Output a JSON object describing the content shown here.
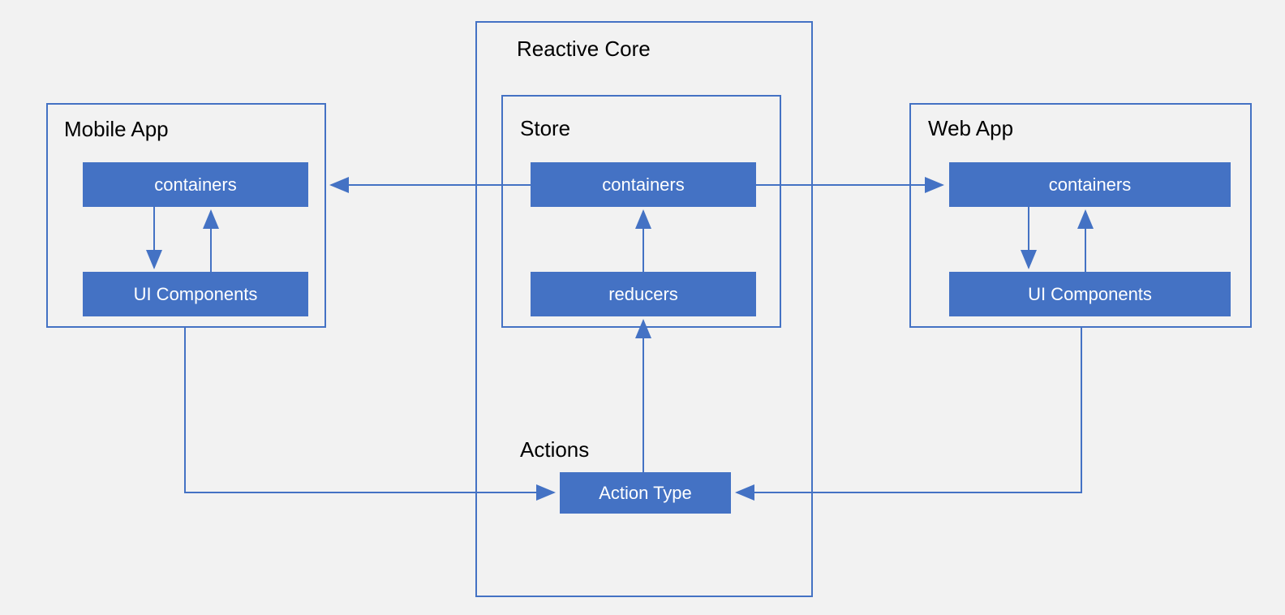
{
  "colors": {
    "accent": "#4472c4",
    "background": "#f2f2f2",
    "text": "#000000",
    "block_text": "#ffffff"
  },
  "mobile": {
    "title": "Mobile App",
    "containers": "containers",
    "ui_components": "UI Components"
  },
  "core": {
    "title": "Reactive Core",
    "store_title": "Store",
    "containers": "containers",
    "reducers": "reducers",
    "actions_title": "Actions",
    "action_type": "Action Type"
  },
  "web": {
    "title": "Web App",
    "containers": "containers",
    "ui_components": "UI Components"
  }
}
